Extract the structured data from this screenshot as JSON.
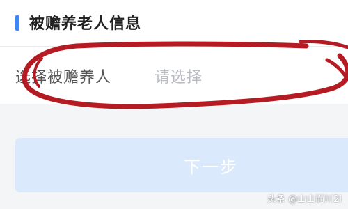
{
  "section": {
    "title": "被赡养老人信息"
  },
  "field": {
    "label": "选择被赡养人",
    "placeholder": "请选择"
  },
  "next_button": {
    "label": "下一步"
  },
  "watermark": {
    "text": "头条 @山山而川2i"
  },
  "colors": {
    "accent": "#3f86f7",
    "annotation_ink": "#b51b22",
    "button_disabled": "#dbe9fc"
  }
}
